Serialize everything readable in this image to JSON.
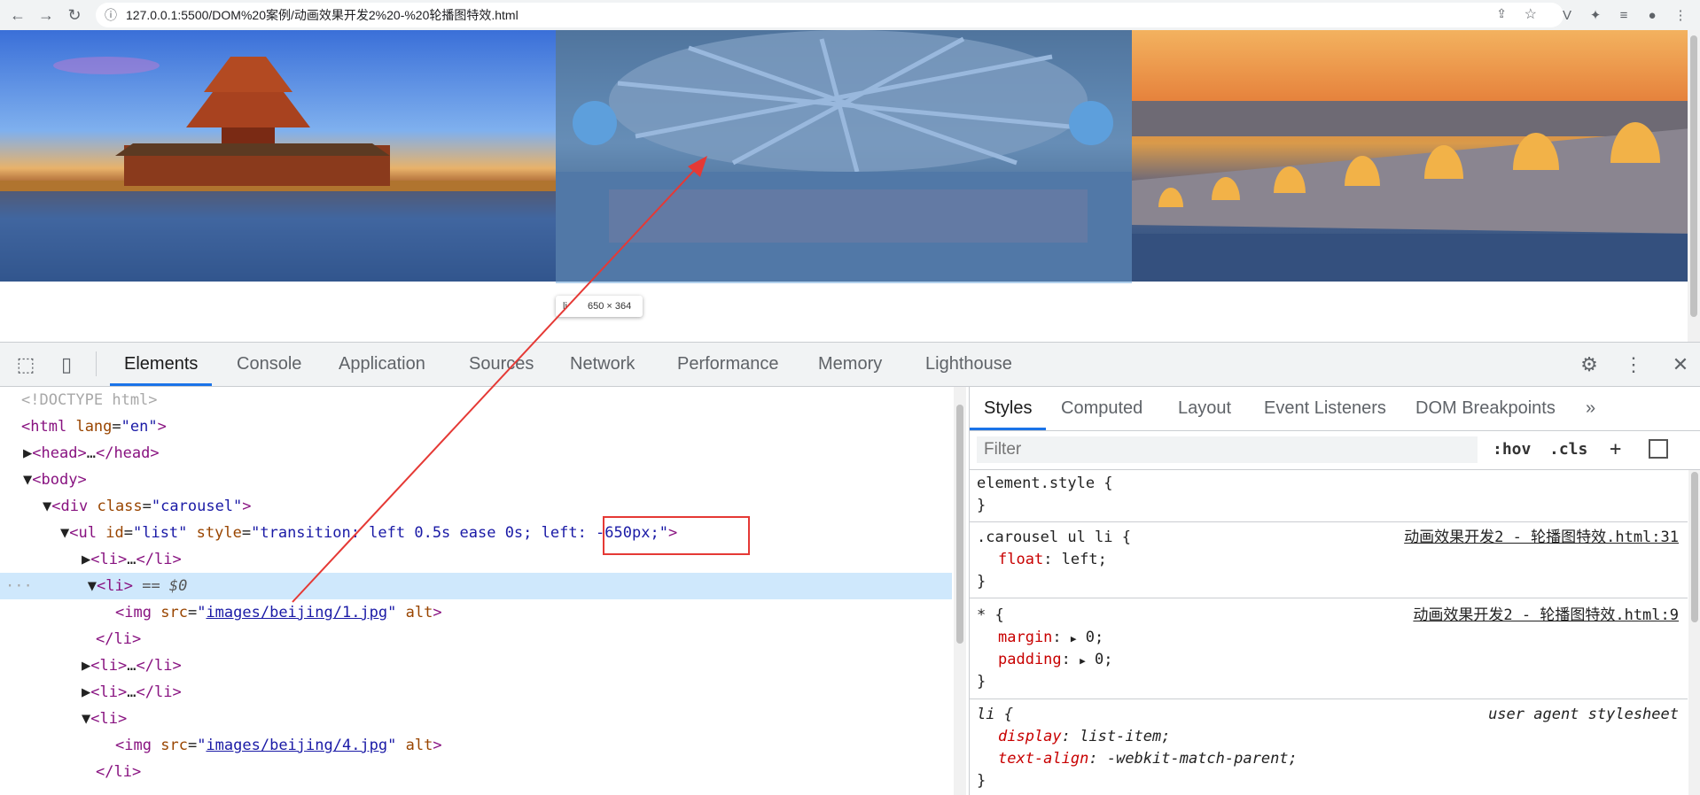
{
  "browser": {
    "url": "127.0.0.1:5500/DOM%20案例/动画效果开发2%20-%20轮播图特效.html"
  },
  "page": {
    "size_tooltip": "650 × 364"
  },
  "devtools": {
    "tabs": [
      "Elements",
      "Console",
      "Application",
      "Sources",
      "Network",
      "Performance",
      "Memory",
      "Lighthouse"
    ],
    "active_tab": "Elements",
    "dom": {
      "doctype": "<!DOCTYPE html>",
      "html_tag": "html",
      "html_attr": "lang",
      "html_val": "en",
      "head": "head",
      "head_ellipsis": "…",
      "body": "body",
      "div": "div",
      "div_attr": "class",
      "div_val": "carousel",
      "ul": "ul",
      "ul_id_attr": "id",
      "ul_id_val": "list",
      "ul_style_attr": "style",
      "ul_style_val_a": "transition: left 0.5s ease 0s; ",
      "ul_style_val_b": "left: -650px;",
      "li": "li",
      "ellipsis": "…",
      "selected_marker": "== $0",
      "dots": "···",
      "img": "img",
      "src_attr": "src",
      "alt_attr": "alt",
      "img1_src": "images/beijing/1.jpg",
      "img4_src": "images/beijing/4.jpg"
    },
    "styles": {
      "tabs": [
        "Styles",
        "Computed",
        "Layout",
        "Event Listeners",
        "DOM Breakpoints"
      ],
      "active_tab": "Styles",
      "more_tabs": "»",
      "filter_placeholder": "Filter",
      "hov": ":hov",
      "cls": ".cls",
      "add": "+",
      "rules": [
        {
          "selector": "element.style {",
          "source": "",
          "props": [],
          "close": "}"
        },
        {
          "selector": ".carousel ul li {",
          "source": "动画效果开发2 - 轮播图特效.html:31",
          "props": [
            {
              "name": "float",
              "value": "left;"
            }
          ],
          "close": "}"
        },
        {
          "selector": "* {",
          "source": "动画效果开发2 - 轮播图特效.html:9",
          "props": [
            {
              "name": "margin",
              "value": "0;"
            },
            {
              "name": "padding",
              "value": "0;"
            }
          ],
          "close": "}"
        },
        {
          "selector": "li {",
          "source": "user agent stylesheet",
          "props": [
            {
              "name": "display",
              "value": "list-item;"
            },
            {
              "name": "text-align",
              "value": "-webkit-match-parent;"
            }
          ],
          "close": "}"
        }
      ]
    }
  },
  "colors": {
    "accent": "#1a73e8",
    "annotation_red": "#e53935",
    "tag": "#881280",
    "attr": "#994500",
    "value": "#1a1aa6",
    "highlight": "#6fa8dc"
  }
}
